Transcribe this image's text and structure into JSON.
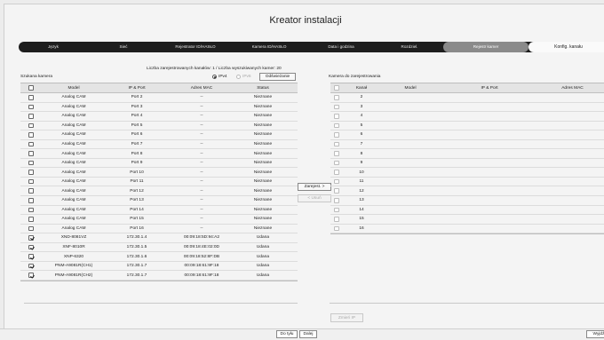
{
  "window": {
    "title": "Kreator instalacji"
  },
  "steps": [
    "Język",
    "Sieć",
    "Rejestrator ID/HASŁO",
    "Kamera ID/HASŁO",
    "Data i godzina",
    "Rozdziel.",
    "Rejestr kamer",
    "Konfig. kanału"
  ],
  "summary": "Liczba zarejestrowanych kanałów: 1 / Liczba wyszukiwanych kamer: 20",
  "searched": {
    "title": "Szukana kamera",
    "ipv4_label": "IPv4",
    "ipv6_label": "IPv6",
    "ipv4_selected": true,
    "refresh_label": "Odświeżanie",
    "columns": [
      "Model",
      "IP & Port",
      "Adres MAC",
      "Status"
    ],
    "rows": [
      {
        "checked": false,
        "model": "Analog CAM",
        "ip": "Port 2",
        "mac": "--",
        "status": "Nieznane"
      },
      {
        "checked": false,
        "model": "Analog CAM",
        "ip": "Port 3",
        "mac": "--",
        "status": "Nieznane"
      },
      {
        "checked": false,
        "model": "Analog CAM",
        "ip": "Port 4",
        "mac": "--",
        "status": "Nieznane"
      },
      {
        "checked": false,
        "model": "Analog CAM",
        "ip": "Port 5",
        "mac": "--",
        "status": "Nieznane"
      },
      {
        "checked": false,
        "model": "Analog CAM",
        "ip": "Port 6",
        "mac": "--",
        "status": "Nieznane"
      },
      {
        "checked": false,
        "model": "Analog CAM",
        "ip": "Port 7",
        "mac": "--",
        "status": "Nieznane"
      },
      {
        "checked": false,
        "model": "Analog CAM",
        "ip": "Port 8",
        "mac": "--",
        "status": "Nieznane"
      },
      {
        "checked": false,
        "model": "Analog CAM",
        "ip": "Port 9",
        "mac": "--",
        "status": "Nieznane"
      },
      {
        "checked": false,
        "model": "Analog CAM",
        "ip": "Port 10",
        "mac": "--",
        "status": "Nieznane"
      },
      {
        "checked": false,
        "model": "Analog CAM",
        "ip": "Port 11",
        "mac": "--",
        "status": "Nieznane"
      },
      {
        "checked": false,
        "model": "Analog CAM",
        "ip": "Port 12",
        "mac": "--",
        "status": "Nieznane"
      },
      {
        "checked": false,
        "model": "Analog CAM",
        "ip": "Port 13",
        "mac": "--",
        "status": "Nieznane"
      },
      {
        "checked": false,
        "model": "Analog CAM",
        "ip": "Port 14",
        "mac": "--",
        "status": "Nieznane"
      },
      {
        "checked": false,
        "model": "Analog CAM",
        "ip": "Port 15",
        "mac": "--",
        "status": "Nieznane"
      },
      {
        "checked": false,
        "model": "Analog CAM",
        "ip": "Port 16",
        "mac": "--",
        "status": "Nieznane"
      },
      {
        "checked": true,
        "model": "XND-8081VZ",
        "ip": "172.30.1.4",
        "mac": "00:09:18:5D:94:A2",
        "status": "Udana"
      },
      {
        "checked": true,
        "model": "XNF-8010R",
        "ip": "172.30.1.5",
        "mac": "00:09:18:4E:02:0D",
        "status": "Udana"
      },
      {
        "checked": true,
        "model": "XNP-6320",
        "ip": "172.30.1.6",
        "mac": "00:09:18:52:8F:DB",
        "status": "Udana"
      },
      {
        "checked": true,
        "model": "PNM-A9081R(CH1)",
        "ip": "172.30.1.7",
        "mac": "00:09:18:61:9F:18",
        "status": "Udana"
      },
      {
        "checked": true,
        "model": "PNM-A9081R(CH2)",
        "ip": "172.30.1.7",
        "mac": "00:09:18:61:9F:18",
        "status": "Udana"
      }
    ]
  },
  "register_button": "Zarejest. >",
  "remove_button": "< Usuń",
  "registered": {
    "title": "Kamera do zarejestrowania",
    "columns": [
      "Kanał",
      "Model",
      "IP & Port",
      "Adres MAC"
    ],
    "channels": [
      "2",
      "3",
      "4",
      "5",
      "6",
      "7",
      "8",
      "9",
      "10",
      "11",
      "12",
      "13",
      "14",
      "15",
      "16"
    ]
  },
  "change_ip_button": "Zmień IP",
  "back_button": "Do tyłu",
  "next_button": "Dalej",
  "exit_button": "Wyjdź"
}
